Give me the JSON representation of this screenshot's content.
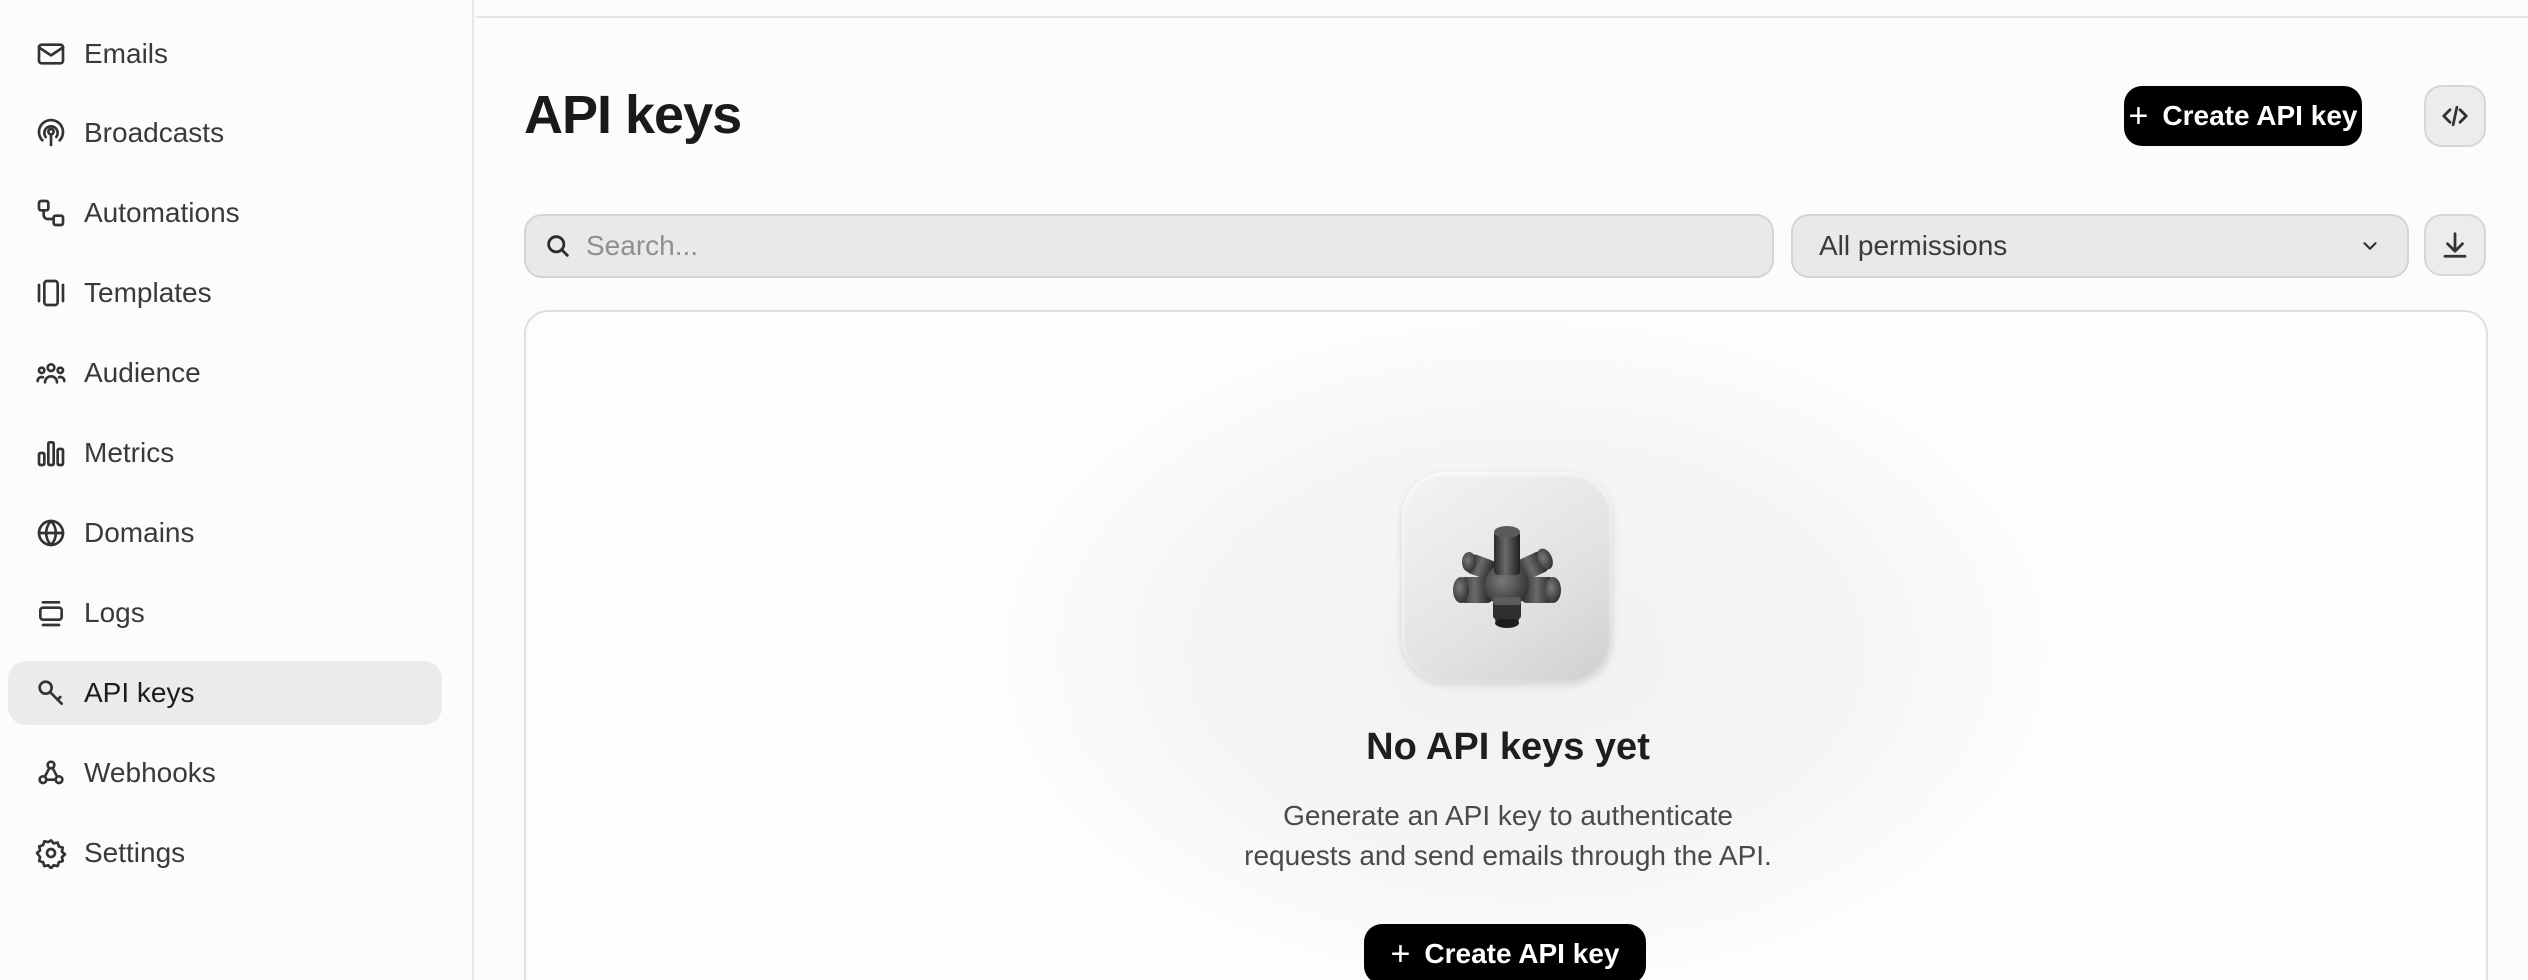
{
  "sidebar": {
    "items": [
      {
        "label": "Emails",
        "icon": "mail-icon"
      },
      {
        "label": "Broadcasts",
        "icon": "broadcast-icon"
      },
      {
        "label": "Automations",
        "icon": "automation-icon"
      },
      {
        "label": "Templates",
        "icon": "templates-icon"
      },
      {
        "label": "Audience",
        "icon": "audience-icon"
      },
      {
        "label": "Metrics",
        "icon": "metrics-icon"
      },
      {
        "label": "Domains",
        "icon": "globe-icon"
      },
      {
        "label": "Logs",
        "icon": "logs-icon"
      },
      {
        "label": "API keys",
        "icon": "key-icon",
        "active": true
      },
      {
        "label": "Webhooks",
        "icon": "webhook-icon"
      },
      {
        "label": "Settings",
        "icon": "gear-icon"
      }
    ]
  },
  "header": {
    "title": "API keys",
    "create_label": "Create API key"
  },
  "filters": {
    "search_placeholder": "Search...",
    "permissions_value": "All permissions"
  },
  "empty_state": {
    "title": "No API keys yet",
    "desc_line1": "Generate an API key to authenticate",
    "desc_line2": "requests and send emails through the API.",
    "create_label": "Create API key"
  },
  "colors": {
    "primary_button": "#000000",
    "active_nav_bg": "#ebebeb"
  }
}
